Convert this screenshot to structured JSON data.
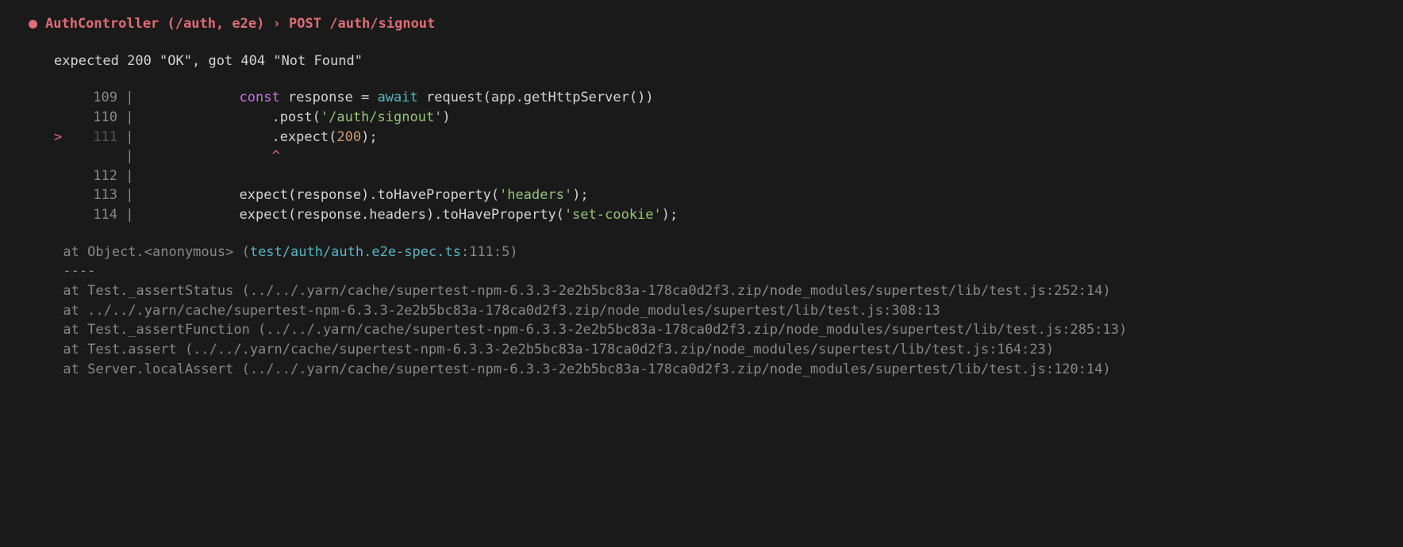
{
  "header": {
    "title": "AuthController (/auth, e2e) › POST /auth/signout"
  },
  "message": "expected 200 \"OK\", got 404 \"Not Found\"",
  "code": {
    "lines": [
      {
        "num": "109",
        "arrow": "",
        "tokens": [
          {
            "cls": "tok-plain",
            "t": "            "
          },
          {
            "cls": "tok-keyword",
            "t": "const"
          },
          {
            "cls": "tok-plain",
            "t": " response = "
          },
          {
            "cls": "tok-await",
            "t": "await"
          },
          {
            "cls": "tok-plain",
            "t": " request(app.getHttpServer())"
          }
        ]
      },
      {
        "num": "110",
        "arrow": "",
        "tokens": [
          {
            "cls": "tok-plain",
            "t": "                .post("
          },
          {
            "cls": "tok-string",
            "t": "'/auth/signout'"
          },
          {
            "cls": "tok-plain",
            "t": ")"
          }
        ]
      },
      {
        "num": "111",
        "arrow": ">",
        "active": true,
        "tokens": [
          {
            "cls": "tok-plain",
            "t": "                .expect("
          },
          {
            "cls": "tok-number",
            "t": "200"
          },
          {
            "cls": "tok-plain",
            "t": ");"
          }
        ]
      },
      {
        "num": "",
        "arrow": "",
        "tokens": [
          {
            "cls": "tok-plain",
            "t": "                "
          },
          {
            "cls": "caret-indicator",
            "t": "^"
          }
        ]
      },
      {
        "num": "112",
        "arrow": "",
        "tokens": []
      },
      {
        "num": "113",
        "arrow": "",
        "tokens": [
          {
            "cls": "tok-plain",
            "t": "            expect(response).toHaveProperty("
          },
          {
            "cls": "tok-string",
            "t": "'headers'"
          },
          {
            "cls": "tok-plain",
            "t": ");"
          }
        ]
      },
      {
        "num": "114",
        "arrow": "",
        "tokens": [
          {
            "cls": "tok-plain",
            "t": "            expect(response.headers).toHaveProperty("
          },
          {
            "cls": "tok-string",
            "t": "'set-cookie'"
          },
          {
            "cls": "tok-plain",
            "t": ");"
          }
        ]
      }
    ]
  },
  "stack": {
    "first": {
      "prefix": "      at Object.<anonymous> (",
      "file": "test/auth/auth.e2e-spec.ts",
      "suffix": ":111:5)"
    },
    "sep": "      ----",
    "rest": [
      "      at Test._assertStatus (../../.yarn/cache/supertest-npm-6.3.3-2e2b5bc83a-178ca0d2f3.zip/node_modules/supertest/lib/test.js:252:14)",
      "      at ../../.yarn/cache/supertest-npm-6.3.3-2e2b5bc83a-178ca0d2f3.zip/node_modules/supertest/lib/test.js:308:13",
      "      at Test._assertFunction (../../.yarn/cache/supertest-npm-6.3.3-2e2b5bc83a-178ca0d2f3.zip/node_modules/supertest/lib/test.js:285:13)",
      "      at Test.assert (../../.yarn/cache/supertest-npm-6.3.3-2e2b5bc83a-178ca0d2f3.zip/node_modules/supertest/lib/test.js:164:23)",
      "      at Server.localAssert (../../.yarn/cache/supertest-npm-6.3.3-2e2b5bc83a-178ca0d2f3.zip/node_modules/supertest/lib/test.js:120:14)"
    ]
  }
}
